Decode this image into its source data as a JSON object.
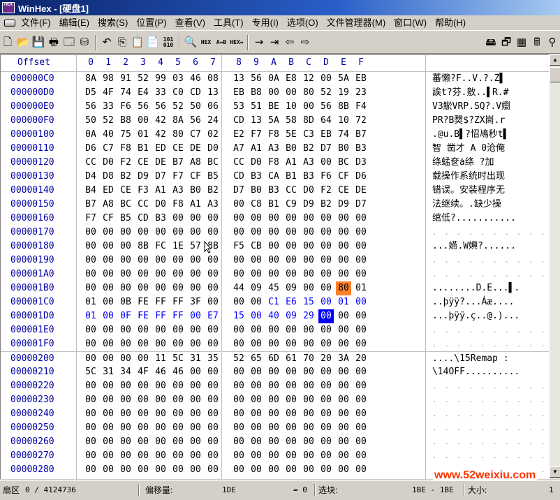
{
  "window": {
    "title": "WinHex - [硬盘1]",
    "icon": "winhex-hex-icon",
    "icon_text": "HEX"
  },
  "menu": [
    "文件(F)",
    "编辑(E)",
    "搜索(S)",
    "位置(P)",
    "查看(V)",
    "工具(T)",
    "专用(I)",
    "选项(O)",
    "文件管理器(M)",
    "窗口(W)",
    "帮助(H)"
  ],
  "toolbar": [
    {
      "name": "new-file-icon",
      "glyph": "🗋"
    },
    {
      "name": "open-folder-icon",
      "glyph": "📂"
    },
    {
      "name": "save-icon",
      "glyph": "💾"
    },
    {
      "name": "print-icon",
      "glyph": "🖶"
    },
    {
      "name": "properties-icon",
      "glyph": "🗔"
    },
    {
      "name": "open-disk-icon",
      "glyph": "⛁"
    },
    {
      "sep": true
    },
    {
      "name": "undo-icon",
      "glyph": "↶"
    },
    {
      "name": "copy-icon",
      "glyph": "⎘"
    },
    {
      "name": "paste-icon",
      "glyph": "📋"
    },
    {
      "name": "paste-special-icon",
      "glyph": "📄"
    },
    {
      "name": "convert-binary-icon",
      "text": "101\n010"
    },
    {
      "sep": true
    },
    {
      "name": "find-icon",
      "glyph": "🔍"
    },
    {
      "name": "find-hex-icon",
      "text": "HEX"
    },
    {
      "name": "replace-text-icon",
      "text": "A↔B"
    },
    {
      "name": "replace-hex-icon",
      "text": "HEX↔"
    },
    {
      "sep": true
    },
    {
      "name": "goto-offset-icon",
      "glyph": "→"
    },
    {
      "name": "goto-sector-icon",
      "glyph": "⇥"
    },
    {
      "name": "back-icon",
      "glyph": "⇦"
    },
    {
      "name": "forward-icon",
      "glyph": "⇨"
    },
    {
      "spacer": true
    },
    {
      "name": "disk-editor-icon",
      "glyph": "🖴"
    },
    {
      "name": "windows-icon",
      "glyph": "🗗"
    },
    {
      "name": "ram-editor-icon",
      "glyph": "▦"
    },
    {
      "name": "calculator-icon",
      "glyph": "🖩"
    },
    {
      "name": "magnifier-icon",
      "glyph": "⚲"
    }
  ],
  "header": {
    "offset_label": "Offset",
    "columns": [
      "0",
      "1",
      "2",
      "3",
      "4",
      "5",
      "6",
      "7",
      "8",
      "9",
      "A",
      "B",
      "C",
      "D",
      "E",
      "F"
    ]
  },
  "rows": [
    {
      "offset": "000000C0",
      "bytes": [
        "8A",
        "98",
        "91",
        "52",
        "99",
        "03",
        "46",
        "08",
        "13",
        "56",
        "0A",
        "E8",
        "12",
        "00",
        "5A",
        "EB"
      ],
      "text": "蕃懒?F..V.?.Z▌"
    },
    {
      "offset": "000000D0",
      "bytes": [
        "D5",
        "4F",
        "74",
        "E4",
        "33",
        "C0",
        "CD",
        "13",
        "EB",
        "B8",
        "00",
        "00",
        "80",
        "52",
        "19",
        "23"
      ],
      "text": "誒t?芬.敫..▌R.#"
    },
    {
      "offset": "000000E0",
      "bytes": [
        "56",
        "33",
        "F6",
        "56",
        "56",
        "52",
        "50",
        "06",
        "53",
        "51",
        "BE",
        "10",
        "00",
        "56",
        "8B",
        "F4"
      ],
      "text": "V3鯲VRP.SQ?.V嬼"
    },
    {
      "offset": "000000F0",
      "bytes": [
        "50",
        "52",
        "B8",
        "00",
        "42",
        "8A",
        "56",
        "24",
        "CD",
        "13",
        "5A",
        "58",
        "8D",
        "64",
        "10",
        "72"
      ],
      "text": "PR?B奦$?ZX峝.r"
    },
    {
      "offset": "00000100",
      "bytes": [
        "0A",
        "40",
        "75",
        "01",
        "42",
        "80",
        "C7",
        "02",
        "E2",
        "F7",
        "F8",
        "5E",
        "C3",
        "EB",
        "74",
        "B7"
      ],
      "text": ".@u.B▌?怊鳰秒t▌"
    },
    {
      "offset": "00000110",
      "bytes": [
        "D6",
        "C7",
        "F8",
        "B1",
        "ED",
        "CE",
        "DE",
        "D0",
        "A7",
        "A1",
        "A3",
        "B0",
        "B2",
        "D7",
        "B0",
        "B3"
      ],
      "text": "智  凿才 A 0沧俺"
    },
    {
      "offset": "00000120",
      "bytes": [
        "CC",
        "D0",
        "F2",
        "CE",
        "DE",
        "B7",
        "A8",
        "BC",
        "CC",
        "D0",
        "F8",
        "A1",
        "A3",
        "00",
        "BC",
        "D3"
      ],
      "text": "绦蜢奁ȧ绦  ?加"
    },
    {
      "offset": "00000130",
      "bytes": [
        "D4",
        "D8",
        "B2",
        "D9",
        "D7",
        "F7",
        "CF",
        "B5",
        "CD",
        "B3",
        "CA",
        "B1",
        "B3",
        "F6",
        "CF",
        "D6"
      ],
      "text": "载操作系统时出现"
    },
    {
      "offset": "00000140",
      "bytes": [
        "B4",
        "ED",
        "CE",
        "F3",
        "A1",
        "A3",
        "B0",
        "B2",
        "D7",
        "B0",
        "B3",
        "CC",
        "D0",
        "F2",
        "CE",
        "DE"
      ],
      "text": "错误。安装程序无"
    },
    {
      "offset": "00000150",
      "bytes": [
        "B7",
        "A8",
        "BC",
        "CC",
        "D0",
        "F8",
        "A1",
        "A3",
        "00",
        "C8",
        "B1",
        "C9",
        "D9",
        "B2",
        "D9",
        "D7"
      ],
      "text": "法继续。.缺少操"
    },
    {
      "offset": "00000160",
      "bytes": [
        "F7",
        "CF",
        "B5",
        "CD",
        "B3",
        "00",
        "00",
        "00",
        "00",
        "00",
        "00",
        "00",
        "00",
        "00",
        "00",
        "00"
      ],
      "text": "绾低?..........."
    },
    {
      "offset": "00000170",
      "bytes": [
        "00",
        "00",
        "00",
        "00",
        "00",
        "00",
        "00",
        "00",
        "00",
        "00",
        "00",
        "00",
        "00",
        "00",
        "00",
        "00"
      ],
      "text": ""
    },
    {
      "offset": "00000180",
      "bytes": [
        "00",
        "00",
        "00",
        "8B",
        "FC",
        "1E",
        "57",
        "8B",
        "F5",
        "CB",
        "00",
        "00",
        "00",
        "00",
        "00",
        "00"
      ],
      "text": "...嬿.W嬹?......"
    },
    {
      "offset": "00000190",
      "bytes": [
        "00",
        "00",
        "00",
        "00",
        "00",
        "00",
        "00",
        "00",
        "00",
        "00",
        "00",
        "00",
        "00",
        "00",
        "00",
        "00"
      ],
      "text": ""
    },
    {
      "offset": "000001A0",
      "bytes": [
        "00",
        "00",
        "00",
        "00",
        "00",
        "00",
        "00",
        "00",
        "00",
        "00",
        "00",
        "00",
        "00",
        "00",
        "00",
        "00"
      ],
      "text": ""
    },
    {
      "offset": "000001B0",
      "bytes": [
        "00",
        "00",
        "00",
        "00",
        "00",
        "00",
        "00",
        "00",
        "44",
        "09",
        "45",
        "09",
        "00",
        "00",
        "80",
        "01"
      ],
      "text": "........D.E...▌."
    },
    {
      "offset": "000001C0",
      "bytes": [
        "01",
        "00",
        "0B",
        "FE",
        "FF",
        "FF",
        "3F",
        "00",
        "00",
        "00",
        "C1",
        "E6",
        "15",
        "00",
        "01",
        "00"
      ],
      "text": "..þÿÿ?...Áæ...."
    },
    {
      "offset": "000001D0",
      "bytes": [
        "01",
        "00",
        "0F",
        "FE",
        "FF",
        "FF",
        "00",
        "E7",
        "15",
        "00",
        "40",
        "09",
        "29",
        "00",
        "00",
        "00"
      ],
      "text": "...þÿÿ.ç..@.)..."
    },
    {
      "offset": "000001E0",
      "bytes": [
        "00",
        "00",
        "00",
        "00",
        "00",
        "00",
        "00",
        "00",
        "00",
        "00",
        "00",
        "00",
        "00",
        "00",
        "00",
        "00"
      ],
      "text": ""
    },
    {
      "offset": "000001F0",
      "bytes": [
        "00",
        "00",
        "00",
        "00",
        "00",
        "00",
        "00",
        "00",
        "00",
        "00",
        "00",
        "00",
        "00",
        "00",
        "00",
        "00"
      ],
      "text": ""
    },
    {
      "offset": "00000200",
      "bytes": [
        "00",
        "00",
        "00",
        "00",
        "11",
        "5C",
        "31",
        "35",
        "52",
        "65",
        "6D",
        "61",
        "70",
        "20",
        "3A",
        "20"
      ],
      "text": "....\\15Remap : "
    },
    {
      "offset": "00000210",
      "bytes": [
        "5C",
        "31",
        "34",
        "4F",
        "46",
        "46",
        "00",
        "00",
        "00",
        "00",
        "00",
        "00",
        "00",
        "00",
        "00",
        "00"
      ],
      "text": "\\14OFF.........."
    },
    {
      "offset": "00000220",
      "bytes": [
        "00",
        "00",
        "00",
        "00",
        "00",
        "00",
        "00",
        "00",
        "00",
        "00",
        "00",
        "00",
        "00",
        "00",
        "00",
        "00"
      ],
      "text": ""
    },
    {
      "offset": "00000230",
      "bytes": [
        "00",
        "00",
        "00",
        "00",
        "00",
        "00",
        "00",
        "00",
        "00",
        "00",
        "00",
        "00",
        "00",
        "00",
        "00",
        "00"
      ],
      "text": ""
    },
    {
      "offset": "00000240",
      "bytes": [
        "00",
        "00",
        "00",
        "00",
        "00",
        "00",
        "00",
        "00",
        "00",
        "00",
        "00",
        "00",
        "00",
        "00",
        "00",
        "00"
      ],
      "text": ""
    },
    {
      "offset": "00000250",
      "bytes": [
        "00",
        "00",
        "00",
        "00",
        "00",
        "00",
        "00",
        "00",
        "00",
        "00",
        "00",
        "00",
        "00",
        "00",
        "00",
        "00"
      ],
      "text": ""
    },
    {
      "offset": "00000260",
      "bytes": [
        "00",
        "00",
        "00",
        "00",
        "00",
        "00",
        "00",
        "00",
        "00",
        "00",
        "00",
        "00",
        "00",
        "00",
        "00",
        "00"
      ],
      "text": ""
    },
    {
      "offset": "00000270",
      "bytes": [
        "00",
        "00",
        "00",
        "00",
        "00",
        "00",
        "00",
        "00",
        "00",
        "00",
        "00",
        "00",
        "00",
        "00",
        "00",
        "00"
      ],
      "text": ""
    },
    {
      "offset": "00000280",
      "bytes": [
        "00",
        "00",
        "00",
        "00",
        "00",
        "00",
        "00",
        "00",
        "00",
        "00",
        "00",
        "00",
        "00",
        "00",
        "00",
        "00"
      ],
      "text": ""
    }
  ],
  "colors": {
    "offset": "#0000a8",
    "selection_blue": "#0000ff",
    "highlight_orange": "#ff7f2a",
    "watermark": "#ff3300"
  },
  "statusbar": {
    "sector_label": "扇区",
    "sector_value": "0 / 4124736",
    "offset_label": "偏移量:",
    "offset_value": "1DE",
    "eq_value": "= 0",
    "block_label": "选块:",
    "block_value": "1BE - 1BE",
    "size_label": "大小:",
    "size_value": "1"
  },
  "watermark": "www.52weixiu.com"
}
